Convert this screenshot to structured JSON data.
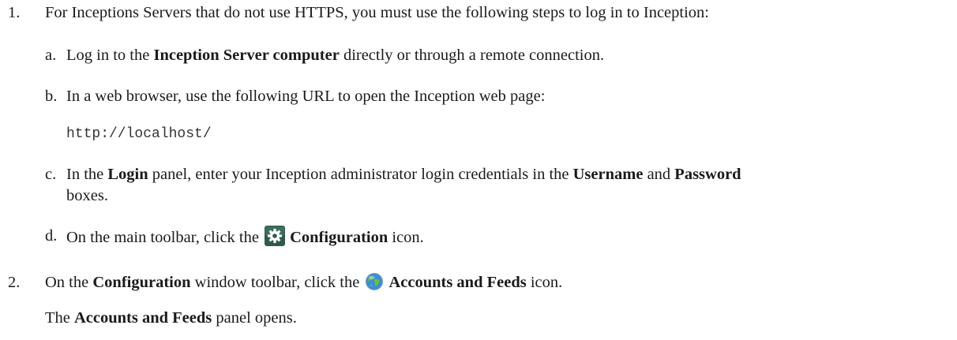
{
  "steps": [
    {
      "number": "1.",
      "text": "For Inceptions Servers that do not use HTTPS, you must use the following steps to log in to Inception:",
      "substeps": [
        {
          "letter": "a.",
          "t1": "Log in to the ",
          "b1": "Inception Server computer",
          "t2": " directly or through a remote connection."
        },
        {
          "letter": "b.",
          "text": "In a web browser, use the following URL to open the Inception web page:",
          "code": "http://localhost/"
        },
        {
          "letter": "c.",
          "t1": "In the ",
          "b1": "Login",
          "t2": " panel, enter your Inception administrator login credentials in the ",
          "b2": "Username",
          "t3": " and ",
          "b3": "Password",
          "t4": "boxes."
        },
        {
          "letter": "d.",
          "t1": "On the main toolbar, click the ",
          "icon": "gear-icon",
          "b1": "Configuration",
          "t2": " icon."
        }
      ]
    },
    {
      "number": "2.",
      "t1": "On the ",
      "b1": "Configuration",
      "t2": " window toolbar, click the ",
      "icon": "globe-icon",
      "b2": "Accounts and Feeds",
      "t3": " icon.",
      "result_b": "Accounts and Feeds",
      "result_prefix": "The ",
      "result_suffix": " panel opens."
    }
  ],
  "colors": {
    "text": "#1a1a1a",
    "gear_bg": "#2f5a4a",
    "globe_blue": "#3d8ed6",
    "globe_green": "#6cbf3a"
  }
}
